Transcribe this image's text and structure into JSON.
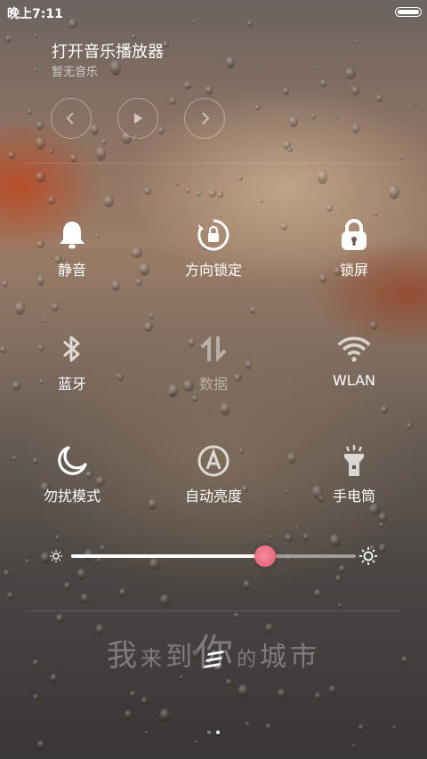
{
  "status_bar": {
    "time": "晚上7:11"
  },
  "music": {
    "title": "打开音乐播放器",
    "subtitle": "暂无音乐"
  },
  "toggles": [
    {
      "label": "静音",
      "icon": "bell-icon",
      "active": true
    },
    {
      "label": "方向锁定",
      "icon": "rotation-lock-icon",
      "active": true
    },
    {
      "label": "锁屏",
      "icon": "lock-icon",
      "active": true
    },
    {
      "label": "蓝牙",
      "icon": "bluetooth-icon",
      "active": true
    },
    {
      "label": "数据",
      "icon": "data-icon",
      "active": false
    },
    {
      "label": "WLAN",
      "icon": "wifi-icon",
      "active": true
    },
    {
      "label": "勿扰模式",
      "icon": "moon-icon",
      "active": true
    },
    {
      "label": "自动亮度",
      "icon": "auto-brightness-icon",
      "active": true
    },
    {
      "label": "手电筒",
      "icon": "flashlight-icon",
      "active": true
    }
  ],
  "brightness": {
    "level": 0.68,
    "thumb_color": "#e45a6e"
  },
  "watermark": {
    "chars": [
      "我",
      "来",
      "到",
      "你",
      "的",
      "城",
      "市"
    ]
  },
  "pager": {
    "pages": 2,
    "current": 2
  }
}
